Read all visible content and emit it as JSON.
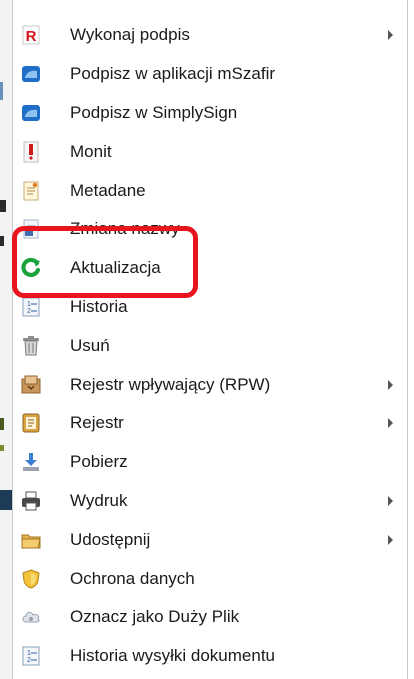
{
  "menu": {
    "items": [
      {
        "label": "Wykonaj podpis",
        "icon": "signature-icon",
        "submenu": true
      },
      {
        "label": "Podpisz w aplikacji mSzafir",
        "icon": "mszafir-icon",
        "submenu": false
      },
      {
        "label": "Podpisz w SimplySign",
        "icon": "simplysign-icon",
        "submenu": false
      },
      {
        "label": "Monit",
        "icon": "reminder-icon",
        "submenu": false
      },
      {
        "label": "Metadane",
        "icon": "metadata-icon",
        "submenu": false
      },
      {
        "label": "Zmiana nazwy",
        "icon": "rename-icon",
        "submenu": false
      },
      {
        "label": "Aktualizacja",
        "icon": "refresh-icon",
        "submenu": false,
        "highlighted": true
      },
      {
        "label": "Historia",
        "icon": "history-icon",
        "submenu": false
      },
      {
        "label": "Usuń",
        "icon": "trash-icon",
        "submenu": false
      },
      {
        "label": "Rejestr wpływający (RPW)",
        "icon": "incoming-register-icon",
        "submenu": true
      },
      {
        "label": "Rejestr",
        "icon": "register-icon",
        "submenu": true
      },
      {
        "label": "Pobierz",
        "icon": "download-icon",
        "submenu": false
      },
      {
        "label": "Wydruk",
        "icon": "printer-icon",
        "submenu": true
      },
      {
        "label": "Udostępnij",
        "icon": "share-folder-icon",
        "submenu": true
      },
      {
        "label": "Ochrona danych",
        "icon": "shield-icon",
        "submenu": false
      },
      {
        "label": "Oznacz jako Duży Plik",
        "icon": "cloud-icon",
        "submenu": false
      },
      {
        "label": "Historia wysyłki dokumentu",
        "icon": "send-history-icon",
        "submenu": false
      }
    ]
  },
  "colors": {
    "highlight": "#e8141e",
    "text": "#1a1a1a",
    "refresh": "#1aa33a",
    "blue": "#1f6fc9"
  }
}
